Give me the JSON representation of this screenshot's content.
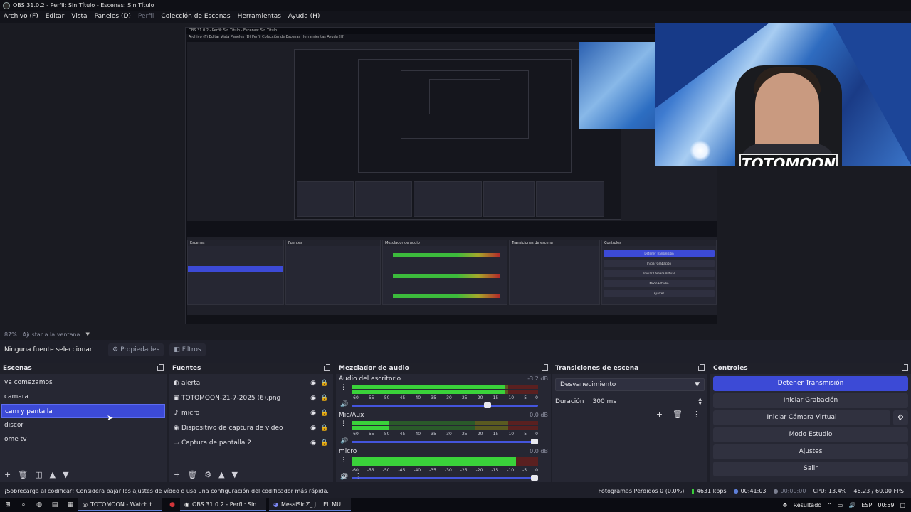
{
  "window": {
    "title": "OBS 31.0.2 - Perfil: Sin Título - Escenas: Sin Título"
  },
  "menu": [
    {
      "label": "Archivo (F)",
      "enabled": true
    },
    {
      "label": "Editar",
      "enabled": true
    },
    {
      "label": "Vista",
      "enabled": true
    },
    {
      "label": "Paneles (D)",
      "enabled": true
    },
    {
      "label": "Perfil",
      "enabled": false
    },
    {
      "label": "Colección de Escenas",
      "enabled": true
    },
    {
      "label": "Herramientas",
      "enabled": true
    },
    {
      "label": "Ayuda (H)",
      "enabled": true
    }
  ],
  "nested_preview": {
    "title": "OBS 31.0.2 - Perfil: Sin Título - Escenas: Sin Título",
    "menu": "Archivo (F)   Editar   Vista   Paneles (D)   Perfil   Colección de Escenas   Herramientas   Ayuda (H)",
    "zoom": "87%   Ajustar a la ventana",
    "source_label": "Ninguna fuente seleccionada",
    "status": "¡Sobrecarga al codificar! Considera bajar los ajustes de vídeo o usa una configuración del codificador más rápida."
  },
  "camera": {
    "logo_text": "TOTOMOON"
  },
  "zoombar": {
    "zoom": "87%",
    "fit": "Ajustar a la ventana"
  },
  "sourcebar": {
    "no_source": "Ninguna fuente seleccionar",
    "properties": "Propiedades",
    "filters": "Filtros"
  },
  "scenes": {
    "title": "Escenas",
    "items": [
      {
        "label": "ya comezamos",
        "selected": false
      },
      {
        "label": "camara",
        "selected": false
      },
      {
        "label": "cam y pantalla",
        "selected": true
      },
      {
        "label": "discor",
        "selected": false
      },
      {
        "label": "ome tv",
        "selected": false
      }
    ]
  },
  "sources": {
    "title": "Fuentes",
    "items": [
      {
        "icon": "alert-icon",
        "glyph": "◐",
        "label": "alerta"
      },
      {
        "icon": "image-icon",
        "glyph": "▣",
        "label": "TOTOMOON-21-7-2025 (6).png"
      },
      {
        "icon": "mic-icon",
        "glyph": "♪",
        "label": "micro"
      },
      {
        "icon": "camera-icon",
        "glyph": "◉",
        "label": "Dispositivo de captura de video"
      },
      {
        "icon": "monitor-icon",
        "glyph": "▭",
        "label": "Captura de pantalla 2"
      }
    ]
  },
  "mixer": {
    "title": "Mezclador de audio",
    "ticks": [
      "-60",
      "-55",
      "-50",
      "-45",
      "-40",
      "-35",
      "-30",
      "-25",
      "-20",
      "-15",
      "-10",
      "-5",
      "0"
    ],
    "channels": [
      {
        "name": "Audio del escritorio",
        "db": "-3.2 dB",
        "level": 0.82,
        "volume": 0.74
      },
      {
        "name": "Mic/Aux",
        "db": "0.0 dB",
        "level": 0.2,
        "volume": 1.0
      },
      {
        "name": "micro",
        "db": "0.0 dB",
        "level": 0.88,
        "volume": 1.0
      }
    ]
  },
  "transitions": {
    "title": "Transiciones de escena",
    "selected": "Desvanecimiento",
    "duration_label": "Duración",
    "duration_value": "300 ms"
  },
  "controls": {
    "title": "Controles",
    "stop_stream": "Detener Transmisión",
    "start_recording": "Iniciar Grabación",
    "start_virtual_cam": "Iniciar Cámara Virtual",
    "studio_mode": "Modo Estudio",
    "settings": "Ajustes",
    "exit": "Salir"
  },
  "status": {
    "message": "¡Sobrecarga al codificar! Considera bajar los ajustes de vídeo o usa una configuración del codificador más rápida.",
    "dropped_frames": "Fotogramas Perdidos 0 (0.0%)",
    "bitrate": "4631 kbps",
    "stream_time": "00:41:03",
    "record_time": "00:00:00",
    "cpu": "CPU: 13.4%",
    "fps": "46.23 / 60.00 FPS"
  },
  "taskbar": {
    "apps": [
      {
        "label": "TOTOMOON - Watch t..."
      },
      {
        "label": "OBS 31.0.2 - Perfil: Sin..."
      },
      {
        "label": "MessiSinZ_ j... EL MU..."
      }
    ],
    "tray_label": "Resultado",
    "language": "ESP",
    "clock": "00:59"
  },
  "colors": {
    "accent": "#3c4ad6",
    "dock_bg": "#262733",
    "panel_head": "#1f2029"
  }
}
